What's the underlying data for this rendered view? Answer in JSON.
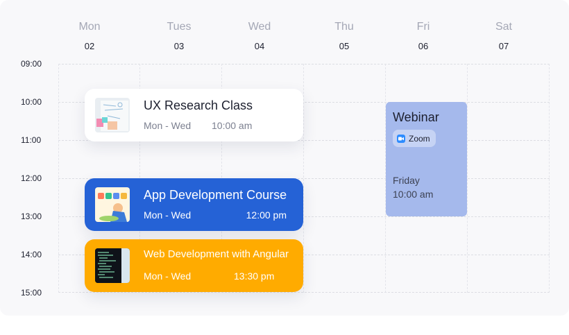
{
  "days": [
    {
      "name": "Mon",
      "num": "02"
    },
    {
      "name": "Tues",
      "num": "03"
    },
    {
      "name": "Wed",
      "num": "04"
    },
    {
      "name": "Thu",
      "num": "05"
    },
    {
      "name": "Fri",
      "num": "06"
    },
    {
      "name": "Sat",
      "num": "07"
    }
  ],
  "times": [
    "09:00",
    "10:00",
    "11:00",
    "12:00",
    "13:00",
    "14:00",
    "15:00"
  ],
  "events": {
    "ux": {
      "title": "UX Research Class",
      "days": "Mon - Wed",
      "time": "10:00 am"
    },
    "app": {
      "title": "App Development Course",
      "days": "Mon - Wed",
      "time": "12:00 pm"
    },
    "web": {
      "title": "Web Development with Angular",
      "days": "Mon - Wed",
      "time": "13:30 pm"
    },
    "webinar": {
      "title": "Webinar",
      "platform": "Zoom",
      "platform_icon": "video-camera-icon",
      "day": "Friday",
      "time": "10:00 am"
    }
  },
  "colors": {
    "app_event": "#2562d6",
    "web_event": "#ffab00",
    "webinar_event": "#a5b9ec",
    "zoom_brand": "#2d8cff"
  }
}
